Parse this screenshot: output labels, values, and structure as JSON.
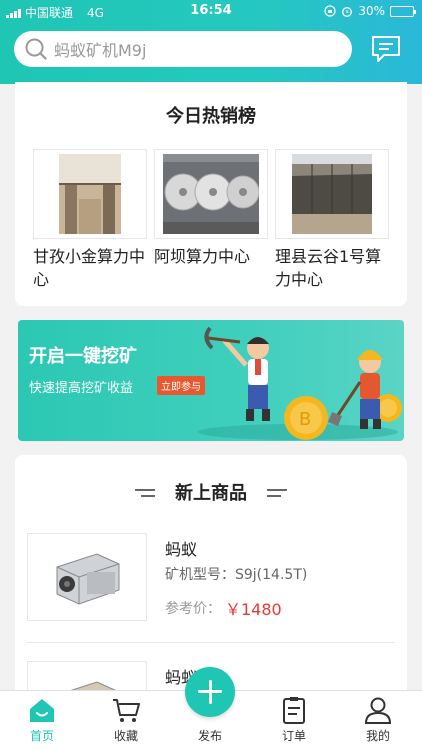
{
  "status_bar": {
    "carrier": "中国联通",
    "network": "4G",
    "time": "16:54",
    "battery": "30%",
    "battery_level": 0.3
  },
  "search": {
    "placeholder": "蚂蚁矿机M9j"
  },
  "hot_list": {
    "title": "今日热销榜",
    "items": [
      {
        "name": "甘孜小金算力中心"
      },
      {
        "name": "阿坝算力中心"
      },
      {
        "name": "理县云谷1号算力中心"
      }
    ]
  },
  "banner": {
    "title": "开启一键挖矿",
    "subtitle": "快速提高挖矿收益",
    "button": "立即参与"
  },
  "new_goods": {
    "title": "新上商品",
    "products": [
      {
        "name": "蚂蚁",
        "model": "矿机型号：S9j(14.5T)",
        "price_label": "参考价：",
        "price": "￥1480"
      },
      {
        "name": "蚂蚁"
      }
    ]
  },
  "tabbar": {
    "items": [
      {
        "label": "首页",
        "icon": "home-icon",
        "active": true
      },
      {
        "label": "收藏",
        "icon": "cart-icon",
        "active": false
      },
      {
        "label": "发布",
        "icon": "plus-icon",
        "active": false
      },
      {
        "label": "订单",
        "icon": "clipboard-icon",
        "active": false
      },
      {
        "label": "我的",
        "icon": "user-icon",
        "active": false
      }
    ]
  },
  "colors": {
    "accent": "#1fc6b4",
    "price": "#e53935",
    "banner_button": "#e9572f"
  }
}
